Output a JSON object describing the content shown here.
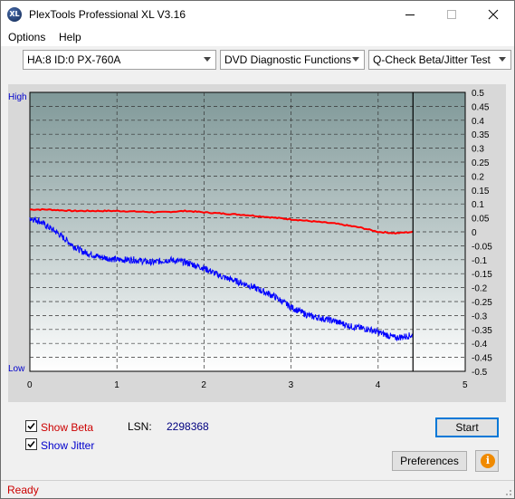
{
  "window": {
    "title": "PlexTools Professional XL V3.16",
    "icon_text": "XL"
  },
  "menu": {
    "options": "Options",
    "help": "Help"
  },
  "toolbar": {
    "drive": "HA:8 ID:0  PX-760A",
    "function": "DVD Diagnostic Functions",
    "test": "Q-Check Beta/Jitter Test"
  },
  "chart_labels": {
    "high": "High",
    "low": "Low"
  },
  "chart_data": {
    "type": "line",
    "xlim": [
      0,
      5
    ],
    "ylim": [
      -0.5,
      0.5
    ],
    "x_ticks": [
      "0",
      "1",
      "2",
      "3",
      "4",
      "5"
    ],
    "y_ticks": [
      "0.5",
      "0.45",
      "0.4",
      "0.35",
      "0.3",
      "0.25",
      "0.2",
      "0.15",
      "0.1",
      "0.05",
      "0",
      "-0.05",
      "-0.1",
      "-0.15",
      "-0.2",
      "-0.25",
      "-0.3",
      "-0.35",
      "-0.4",
      "-0.45",
      "-0.5"
    ],
    "grid": true,
    "end_marker_x": 4.4,
    "series": [
      {
        "color": "#ff0000",
        "x": [
          0,
          0.2,
          0.5,
          1.0,
          1.5,
          1.8,
          2.0,
          2.5,
          3.0,
          3.5,
          3.8,
          4.0,
          4.2,
          4.4
        ],
        "values": [
          0.08,
          0.08,
          0.075,
          0.075,
          0.07,
          0.075,
          0.07,
          0.06,
          0.045,
          0.03,
          0.015,
          0.0,
          -0.005,
          0.0
        ]
      },
      {
        "color": "#0000ff",
        "x": [
          0,
          0.1,
          0.3,
          0.5,
          0.6,
          0.8,
          1.0,
          1.2,
          1.4,
          1.6,
          1.8,
          2.0,
          2.2,
          2.5,
          2.8,
          3.0,
          3.2,
          3.5,
          3.7,
          3.9,
          4.1,
          4.2,
          4.4
        ],
        "values": [
          0.05,
          0.04,
          0.0,
          -0.05,
          -0.07,
          -0.09,
          -0.1,
          -0.1,
          -0.11,
          -0.1,
          -0.11,
          -0.13,
          -0.16,
          -0.19,
          -0.23,
          -0.27,
          -0.3,
          -0.32,
          -0.34,
          -0.35,
          -0.37,
          -0.38,
          -0.37
        ]
      }
    ]
  },
  "options": {
    "show_beta": {
      "label": "Show Beta",
      "checked": true,
      "color": "#cc0000"
    },
    "show_jitter": {
      "label": "Show Jitter",
      "checked": true,
      "color": "#0000cc"
    }
  },
  "lsn": {
    "label": "LSN:",
    "value": "2298368"
  },
  "buttons": {
    "start": "Start",
    "preferences": "Preferences",
    "info_icon": "i"
  },
  "status": {
    "text": "Ready"
  }
}
